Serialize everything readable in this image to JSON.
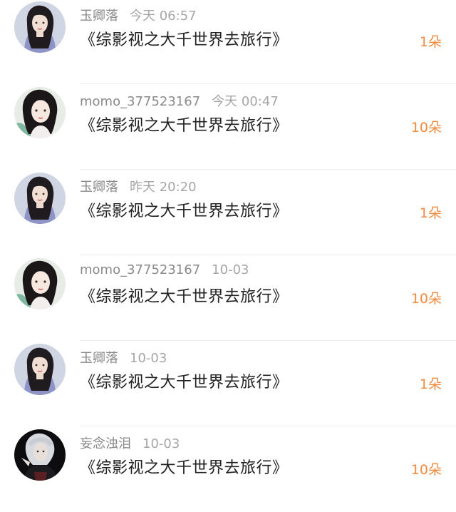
{
  "items": [
    {
      "user": "玉卿落",
      "time": "今天 06:57",
      "title": "《综影视之大千世界去旅行》",
      "gift": "1朵",
      "avatar": "avatar-a"
    },
    {
      "user": "momo_377523167",
      "time": "今天 00:47",
      "title": "《综影视之大千世界去旅行》",
      "gift": "10朵",
      "avatar": "avatar-b"
    },
    {
      "user": "玉卿落",
      "time": "昨天 20:20",
      "title": "《综影视之大千世界去旅行》",
      "gift": "1朵",
      "avatar": "avatar-a"
    },
    {
      "user": "momo_377523167",
      "time": "10-03",
      "title": "《综影视之大千世界去旅行》",
      "gift": "10朵",
      "avatar": "avatar-b"
    },
    {
      "user": "玉卿落",
      "time": "10-03",
      "title": "《综影视之大千世界去旅行》",
      "gift": "1朵",
      "avatar": "avatar-a"
    },
    {
      "user": "妄念浊泪",
      "time": "10-03",
      "title": "《综影视之大千世界去旅行》",
      "gift": "10朵",
      "avatar": "avatar-c"
    }
  ],
  "colors": {
    "gift": "#f08a3e",
    "username": "#8a8a8a",
    "title": "#222222"
  }
}
